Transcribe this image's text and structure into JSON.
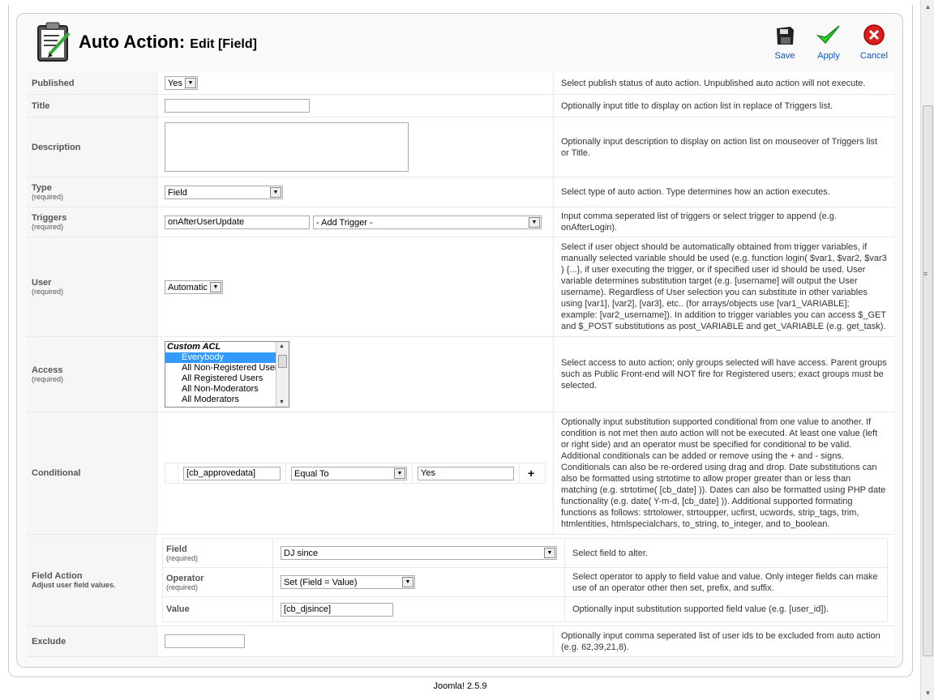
{
  "header": {
    "title": "Auto Action:",
    "subtitle": "Edit [Field]",
    "toolbar": {
      "save": "Save",
      "apply": "Apply",
      "cancel": "Cancel"
    }
  },
  "form": {
    "published": {
      "label": "Published",
      "value": "Yes",
      "help": "Select publish status of auto action. Unpublished auto action will not execute."
    },
    "title": {
      "label": "Title",
      "value": "",
      "help": "Optionally input title to display on action list in replace of Triggers list."
    },
    "description": {
      "label": "Description",
      "value": "",
      "help": "Optionally input description to display on action list on mouseover of Triggers list or Title."
    },
    "type": {
      "label": "Type",
      "required": "(required)",
      "value": "Field",
      "help": "Select type of auto action. Type determines how an action executes."
    },
    "triggers": {
      "label": "Triggers",
      "required": "(required)",
      "value": "onAfterUserUpdate",
      "select": "- Add Trigger -",
      "help": "Input comma seperated list of triggers or select trigger to append (e.g. onAfterLogin)."
    },
    "user": {
      "label": "User",
      "required": "(required)",
      "value": "Automatic",
      "help": "Select if user object should be automatically obtained from trigger variables, if manually selected variable should be used (e.g. function login( $var1, $var2, $var3 ) {...}, if user executing the trigger, or if specified user id should be used. User variable determines substitution target (e.g. [username] will output the User username). Regardless of User selection you can substitute in other variables using [var1], [var2], [var3], etc.. (for arrays/objects use [var1_VARIABLE]; example: [var2_username]). In addition to trigger variables you can access $_GET and $_POST substitutions as post_VARIABLE and get_VARIABLE (e.g. get_task)."
    },
    "access": {
      "label": "Access",
      "required": "(required)",
      "group": "Custom ACL",
      "options": [
        "Everybody",
        "All Non-Registered Users",
        "All Registered Users",
        "All Non-Moderators",
        "All Moderators"
      ],
      "help": "Select access to auto action; only groups selected will have access. Parent groups such as Public Front-end will NOT fire for Registered users; exact groups must be selected."
    },
    "conditional": {
      "label": "Conditional",
      "left": "[cb_approvedata]",
      "operator": "Equal To",
      "right": "Yes",
      "add": "+",
      "help": "Optionally input substitution supported conditional from one value to another. If condition is not met then auto action will not be executed. At least one value (left or right side) and an operator must be specified for conditional to be valid. Additional conditionals can be added or remove using the + and - signs. Conditionals can also be re-ordered using drag and drop. Date substitutions can also be formatted using strtotime to allow proper greater than or less than matching (e.g. strtotime( [cb_date] )). Dates can also be formatted using PHP date functionality (e.g. date( Y-m-d, [cb_date] )). Additional supported formating functions as follows: strtolower, strtoupper, ucfirst, ucwords, strip_tags, trim, htmlentities, htmlspecialchars, to_string, to_integer, and to_boolean."
    },
    "field_action": {
      "label": "Field Action",
      "sub": "Adjust user field values.",
      "field": {
        "label": "Field",
        "required": "(required)",
        "value": "DJ since",
        "help": "Select field to alter."
      },
      "operator": {
        "label": "Operator",
        "required": "(required)",
        "value": "Set (Field = Value)",
        "help": "Select operator to apply to field value and value. Only integer fields can make use of an operator other then set, prefix, and suffix."
      },
      "value": {
        "label": "Value",
        "value": "[cb_djsince]",
        "help": "Optionally input substitution supported field value (e.g. [user_id])."
      }
    },
    "exclude": {
      "label": "Exclude",
      "value": "",
      "help": "Optionally input comma seperated list of user ids to be excluded from auto action (e.g. 62,39,21,8)."
    }
  },
  "footer": "Joomla! 2.5.9"
}
